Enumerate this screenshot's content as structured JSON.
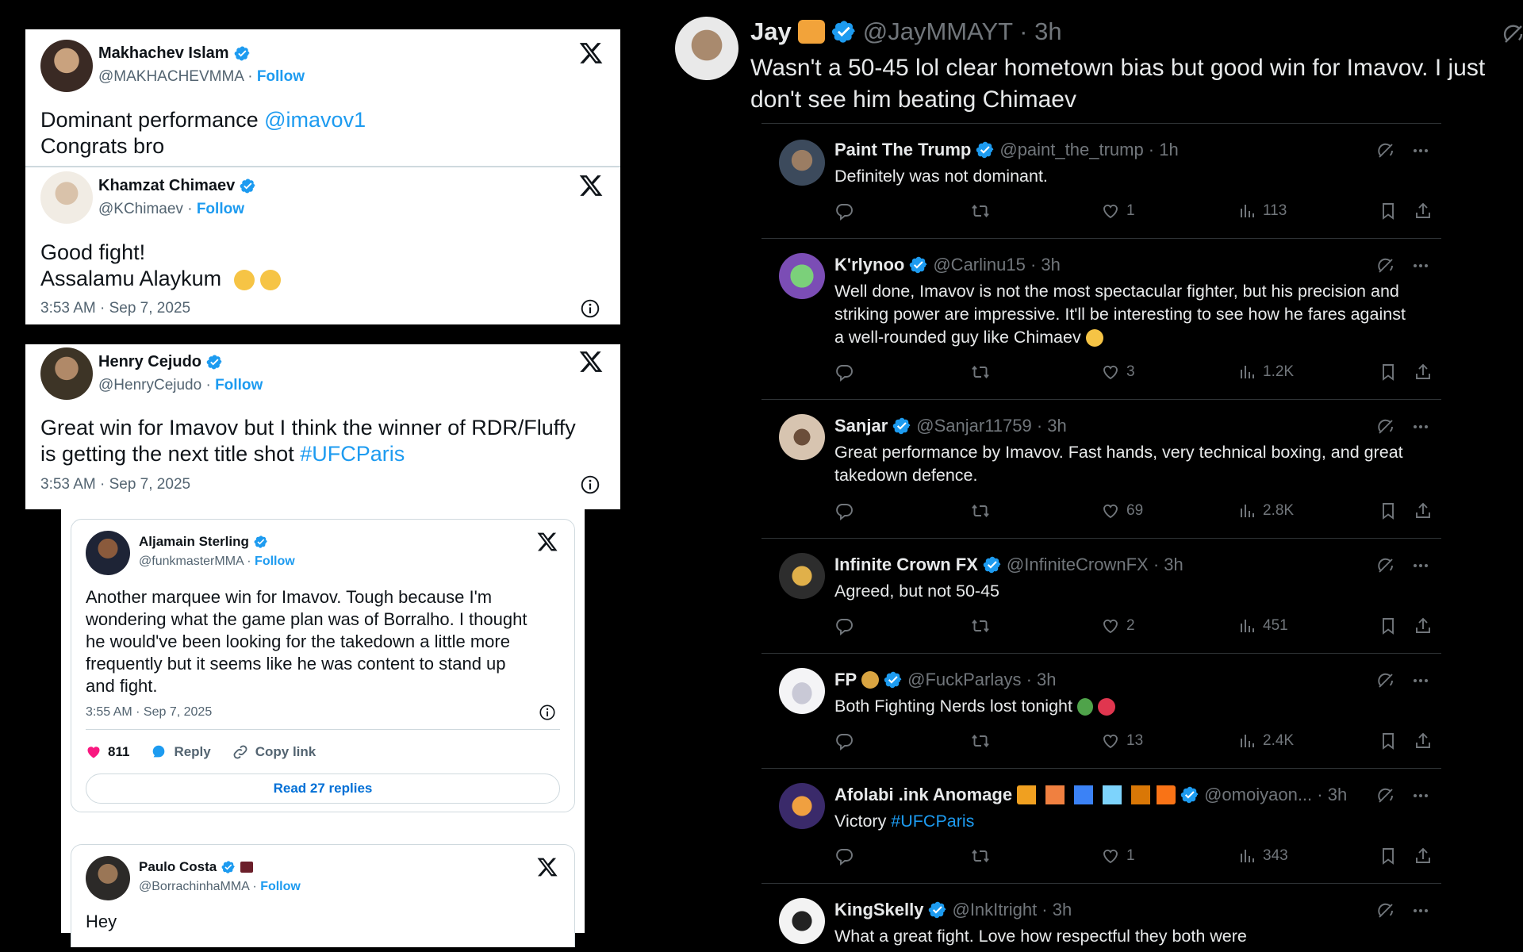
{
  "left_cards": {
    "makhachev": {
      "name": "Makhachev Islam",
      "handle": "@MAKHACHEVMMA",
      "follow": "Follow",
      "text_line1_prefix": "Dominant performance ",
      "text_line1_mention": "@imavov1",
      "text_line2": "Congrats bro"
    },
    "chimaev": {
      "name": "Khamzat Chimaev",
      "handle": "@KChimaev",
      "follow": "Follow",
      "text_line1": "Good fight!",
      "text_line2": "Assalamu Alaykum",
      "timestamp": "3:53 AM · Sep 7, 2025"
    },
    "cejudo": {
      "name": "Henry Cejudo",
      "handle": "@HenryCejudo",
      "follow": "Follow",
      "text_line1": "Great win for Imavov but I think the winner of RDR/Fluffy",
      "text_line2_prefix": "is getting the next title shot ",
      "text_line2_hashtag": "#UFCParis",
      "timestamp": "3:53 AM · Sep 7, 2025"
    },
    "sterling": {
      "name": "Aljamain Sterling",
      "handle": "@funkmasterMMA",
      "follow": "Follow",
      "text_lines": [
        "Another marquee win for Imavov. Tough because I'm",
        "wondering what the game plan was of Borralho. I thought",
        "he would've been looking for the takedown a little more",
        "frequently but it seems like he was content to stand up",
        "and fight."
      ],
      "timestamp": "3:55 AM · Sep 7, 2025",
      "likes": "811",
      "reply_label": "Reply",
      "copy_label": "Copy link",
      "read_replies": "Read 27 replies"
    },
    "costa": {
      "name": "Paulo Costa",
      "handle": "@BorrachinhaMMA",
      "follow": "Follow",
      "text": "Hey"
    }
  },
  "thread": {
    "op": {
      "name": "Jay",
      "handle": "@JayMMAYT",
      "time": "· 3h",
      "text_line1": "Wasn't a 50-45 lol clear hometown bias but good win for Imavov. I just",
      "text_line2": "don't see him beating Chimaev"
    },
    "replies": [
      {
        "name": "Paint The Trump",
        "handle": "@paint_the_trump · 1h",
        "lines": [
          "Definitely was not dominant."
        ],
        "likes": "1",
        "views": "113"
      },
      {
        "name": "K'rlynoo",
        "handle": "@Carlinu15 · 3h",
        "lines": [
          "Well done, Imavov is not the most spectacular fighter, but his precision and",
          "striking power are impressive. It'll be interesting to see how he fares against",
          "a well-rounded guy like Chimaev"
        ],
        "likes": "3",
        "views": "1.2K"
      },
      {
        "name": "Sanjar",
        "handle": "@Sanjar11759 · 3h",
        "lines": [
          "Great performance by Imavov. Fast hands, very technical boxing, and great",
          "takedown defence."
        ],
        "likes": "69",
        "views": "2.8K"
      },
      {
        "name": "Infinite Crown FX",
        "handle": "@InfiniteCrownFX · 3h",
        "lines": [
          "Agreed, but not 50-45"
        ],
        "likes": "2",
        "views": "451"
      },
      {
        "name": "FP",
        "handle": "@FuckParlays · 3h",
        "lines": [
          "Both Fighting Nerds lost tonight"
        ],
        "likes": "13",
        "views": "2.4K"
      },
      {
        "name": "Afolabi .ink Anomage",
        "name_suffix": "(  ,  )  ...",
        "handle": "@omoiyaon... · 3h",
        "lines_prefix": "Victory ",
        "lines_hashtag": "#UFCParis",
        "likes": "1",
        "views": "343"
      },
      {
        "name": "KingSkelly",
        "handle": "@InkItright · 3h",
        "lines": [
          "What a great fight. Love how respectful they both were"
        ]
      }
    ]
  },
  "colors": {
    "accent": "#1d9bf0",
    "dark_bg": "#000000",
    "dark_text": "#e7e9ea",
    "dark_muted": "#71767b",
    "light_muted": "#536471",
    "heart": "#f91880"
  }
}
